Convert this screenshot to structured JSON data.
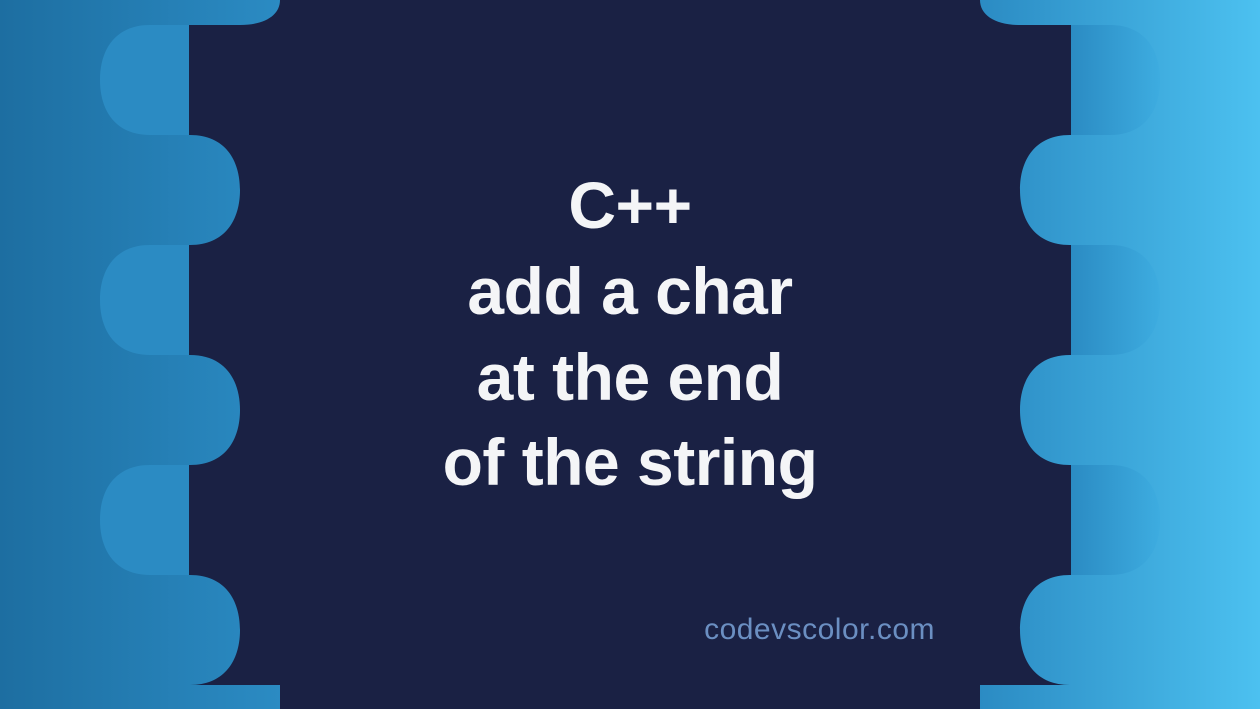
{
  "title": {
    "line1": "C++",
    "line2": "add a char",
    "line3": "at the end",
    "line4": "of the string"
  },
  "watermark": "codevscolor.com",
  "colors": {
    "dark_navy": "#1a2144",
    "blue_left": "#1d6ea1",
    "blue_right": "#4cc1f0",
    "text": "#f4f5f7",
    "watermark": "#6b8fc2"
  }
}
